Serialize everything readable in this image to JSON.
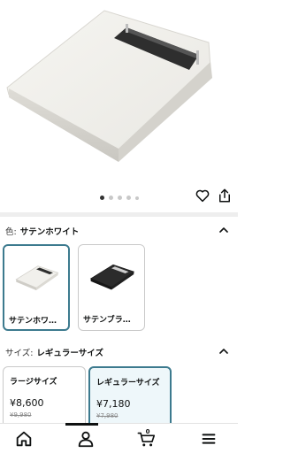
{
  "product": {
    "image_icon": "product-image",
    "carousel_total": 5,
    "carousel_active": 1
  },
  "actions": {
    "wishlist_icon": "heart-icon",
    "share_icon": "share-icon"
  },
  "color_section": {
    "label": "色:",
    "selected": "サテンホワイト",
    "options": [
      {
        "name": "サテンホワ…",
        "color": "#f1f0ec",
        "selected": true
      },
      {
        "name": "サテンブラ…",
        "color": "#2b2b2b",
        "selected": false
      }
    ]
  },
  "size_section": {
    "label": "サイズ:",
    "selected": "レギュラーサイズ",
    "options": [
      {
        "name": "ラージサイズ",
        "price": "¥8,600",
        "old_price": "¥9,980",
        "selected": false
      },
      {
        "name": "レギュラーサイズ",
        "price": "¥7,180",
        "old_price": "¥7,980",
        "selected": true
      }
    ]
  },
  "nav": {
    "cart_count": "0",
    "items": [
      "home-icon",
      "account-icon",
      "cart-icon",
      "menu-icon"
    ]
  },
  "colors": {
    "accent": "#3c7a8e",
    "selected_bg": "#eef7fa"
  }
}
